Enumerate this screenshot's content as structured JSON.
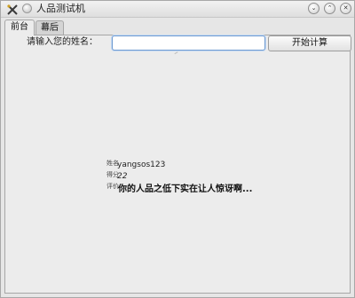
{
  "window": {
    "title": "人品测试机",
    "minimize_glyph": "⌄",
    "maximize_glyph": "⌃",
    "close_glyph": "✕"
  },
  "tabs": [
    {
      "label": "前台",
      "active": true
    },
    {
      "label": "幕后",
      "active": false
    }
  ],
  "form": {
    "name_label": "请输入您的姓名：",
    "name_value": "",
    "calc_button_label": "开始计算"
  },
  "result": {
    "name_label": "姓名",
    "name_value": "yangsos123",
    "score_label": "得分",
    "score_value": "22",
    "comment_label": "评价",
    "comment_value": "你的人品之低下实在让人惊讶啊..."
  },
  "colors": {
    "accent": "#6f9bd1",
    "background": "#ececec"
  }
}
